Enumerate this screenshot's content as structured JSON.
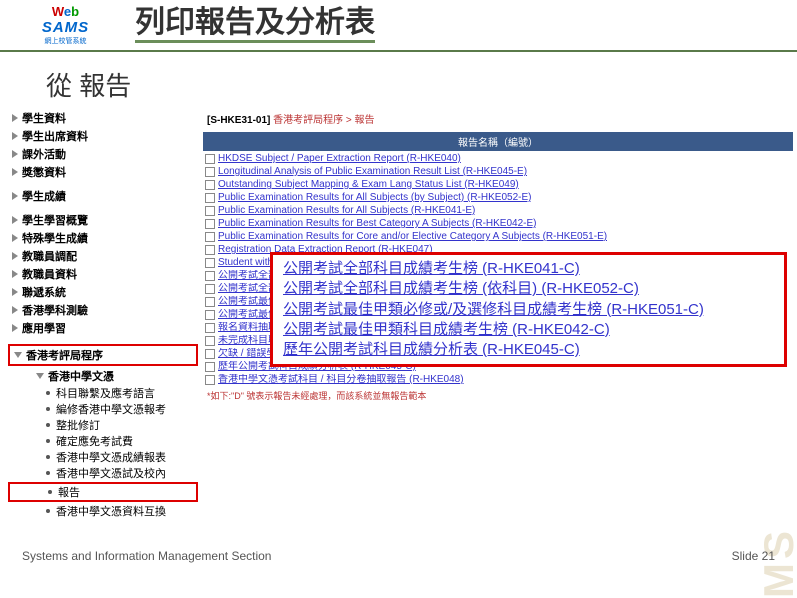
{
  "header": {
    "logo_web": "Web",
    "logo_sams": "SAMS",
    "logo_sub": "網上校管系統",
    "title": "列印報告及分析表"
  },
  "subtitle": "從 報告",
  "sidebar": {
    "items": [
      {
        "label": "學生資料"
      },
      {
        "label": "學生出席資料"
      },
      {
        "label": "課外活動"
      },
      {
        "label": "獎懲資料"
      },
      {
        "label": "學生成績"
      },
      {
        "label": "學生學習概覽"
      },
      {
        "label": "特殊學生成績"
      },
      {
        "label": "教職員調配"
      },
      {
        "label": "教職員資料"
      },
      {
        "label": "聯遞系統"
      },
      {
        "label": "香港學科測驗"
      },
      {
        "label": "應用學習"
      },
      {
        "label": "香港考評局程序",
        "boxed": true
      }
    ],
    "sub": {
      "label": "香港中學文憑",
      "boxed": true
    },
    "sub2": [
      {
        "label": "科目聯繫及應考語言"
      },
      {
        "label": "編修香港中學文憑報考"
      },
      {
        "label": "整批修訂"
      },
      {
        "label": "確定應免考試費"
      },
      {
        "label": "香港中學文憑成績報表"
      },
      {
        "label": "香港中學文憑試及校內"
      },
      {
        "label": "報告",
        "boxed": true
      },
      {
        "label": "香港中學文憑資料互換"
      }
    ]
  },
  "breadcrumb": {
    "code": "[S-HKE31-01]",
    "path": "香港考評局程序 > 報告"
  },
  "table_header": "報告名稱（編號）",
  "reports": [
    "HKDSE Subject / Paper Extraction Report (R-HKE040)",
    "Longitudinal Analysis of Public Examination Result List (R-HKE045-E)",
    "Outstanding Subject Mapping & Exam Lang Status List (R-HKE049)",
    "Public Examination Results for All Subjects (by Subject) (R-HKE052-E)",
    "Public Examination Results for All Subjects (R-HKE041-E)",
    "Public Examination Results for Best Category A Subjects (R-HKE042-E)",
    "Public Examination Results for Core and/or Elective Category A Subjects (R-HKE051-E)",
    "Registration Data Extraction Report (R-HKE047)",
    "Student with Missing/Invalid Particulars (HKDSE Registration) List (R-HKE050)",
    "公開考試全部科目成績考生榜 (R-HKE041-C)",
    "公開考試全部科目成績考生榜 (依科目) (R-HKE052-C)",
    "公開考試最佳甲類必修或/及選修科目成績考生榜 (R-HKE051-C)",
    "公開考試最佳甲類科目成績考生榜 (R-HKE042-C)",
    "報名資料抽取報告 (R-HKE047)",
    "未完成科目聯繫及應考語言學生名單 (R-HKE049)",
    "欠缺 / 錯誤學生個人資料(香港中學文憑報名資料)清單 (R-HKE050)",
    "歷年公開考試科目成績分析表 (R-HKE045-C)",
    "香港中學文憑考試科目 / 科目分卷抽取報告 (R-HKE048)"
  ],
  "footnote": "*如下:\"D\" 號表示報告未經處理，而該系統並無報告範本",
  "callout": [
    "公開考試全部科目成績考生榜 (R-HKE041-C)",
    "公開考試全部科目成績考生榜 (依科目) (R-HKE052-C)",
    "公開考試最佳甲類必修或/及選修科目成績考生榜 (R-HKE051-C)",
    "公開考試最佳甲類科目成績考生榜 (R-HKE042-C)",
    "歷年公開考試科目成績分析表 (R-HKE045-C)"
  ],
  "footer": {
    "left": "Systems and Information Management Section",
    "right": "Slide 21"
  },
  "watermark": "MS"
}
